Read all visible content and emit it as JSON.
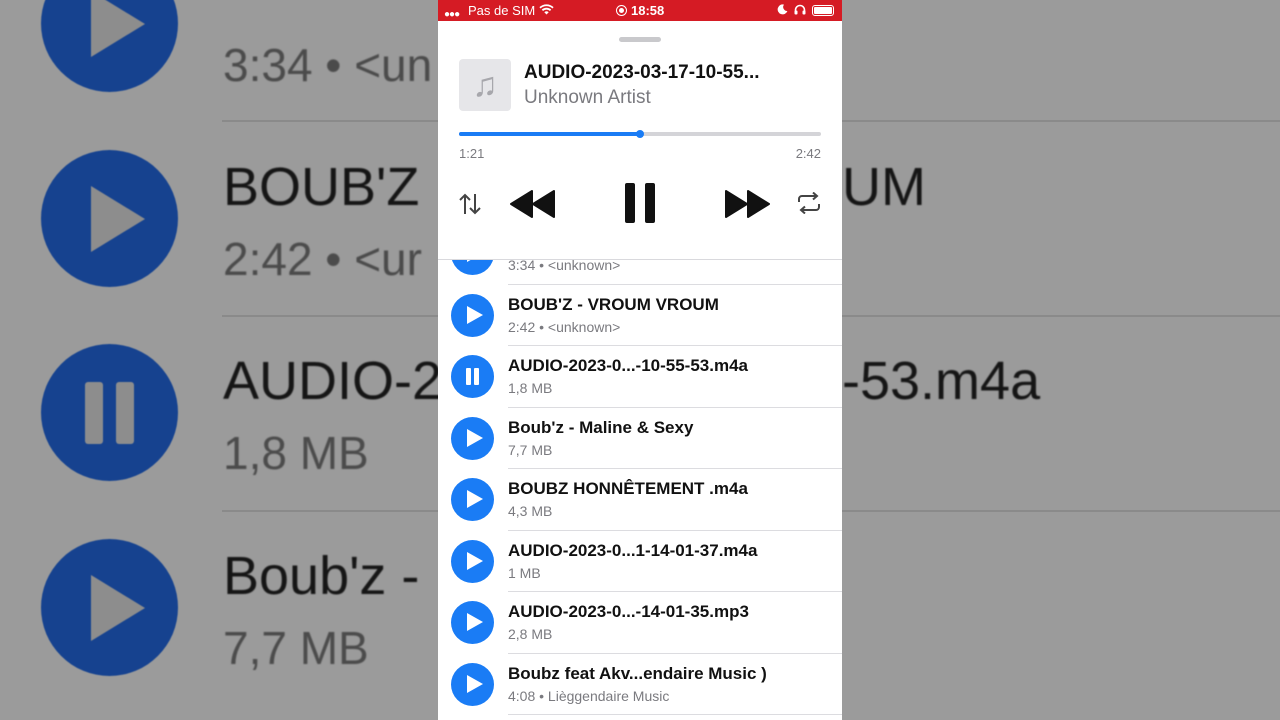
{
  "status_bar": {
    "carrier": "Pas de SIM",
    "time": "18:58"
  },
  "now_playing": {
    "title": "AUDIO-2023-03-17-10-55...",
    "artist": "Unknown Artist",
    "elapsed": "1:21",
    "duration": "2:42",
    "progress_fraction": 0.5,
    "state": "playing"
  },
  "colors": {
    "accent": "#1a7cf5",
    "status_bar": "#d51b24"
  },
  "tracks": [
    {
      "title": "",
      "subtitle": "3:34 • <unknown>",
      "state": "play"
    },
    {
      "title": "BOUB'Z - VROUM VROUM",
      "subtitle": "2:42 • <unknown>",
      "state": "play"
    },
    {
      "title": "AUDIO-2023-0...-10-55-53.m4a",
      "subtitle": "1,8 MB",
      "state": "pause"
    },
    {
      "title": "Boub'z - Maline & Sexy",
      "subtitle": "7,7 MB",
      "state": "play"
    },
    {
      "title": "BOUBZ HONNÊTEMENT .m4a",
      "subtitle": "4,3 MB",
      "state": "play"
    },
    {
      "title": "AUDIO-2023-0...1-14-01-37.m4a",
      "subtitle": "1 MB",
      "state": "play"
    },
    {
      "title": "AUDIO-2023-0...-14-01-35.mp3",
      "subtitle": "2,8 MB",
      "state": "play"
    },
    {
      "title": "Boubz feat Akv...endaire Music )",
      "subtitle": "4:08 • Lièggendaire Music",
      "state": "play"
    }
  ],
  "background_zoom": {
    "rows": [
      {
        "title": "",
        "subtitle": "3:34 • <un",
        "state": "play"
      },
      {
        "title": "BOUB'Z",
        "right_title": "UM",
        "subtitle": "2:42 • <ur",
        "state": "play"
      },
      {
        "title": "AUDIO-2",
        "right_title": "-53.m4a",
        "subtitle": "1,8 MB",
        "state": "pause"
      },
      {
        "title": "Boub'z -",
        "subtitle": "7,7 MB",
        "state": "play"
      }
    ]
  }
}
